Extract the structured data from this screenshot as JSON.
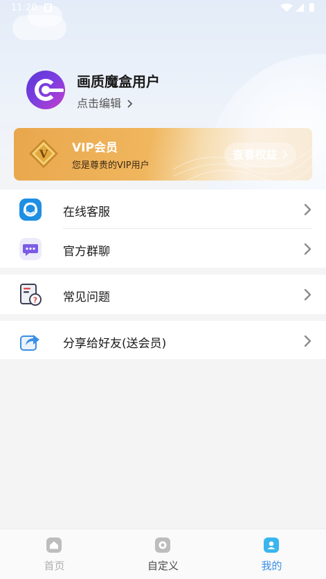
{
  "status_bar": {
    "time": "11:20"
  },
  "profile": {
    "name": "画质魔盒用户",
    "edit_label": "点击编辑"
  },
  "vip": {
    "title": "VIP会员",
    "subtitle": "您是尊贵的VIP用户",
    "button_label": "查看权益",
    "badge_letter": "V"
  },
  "menu": {
    "group1": [
      {
        "label": "在线客服",
        "icon": "customer-service-icon"
      },
      {
        "label": "官方群聊",
        "icon": "group-chat-icon"
      }
    ],
    "group2": [
      {
        "label": "常见问题",
        "icon": "faq-icon"
      }
    ],
    "group3": [
      {
        "label": "分享给好友(送会员)",
        "icon": "share-icon"
      }
    ]
  },
  "tabs": [
    {
      "label": "首页",
      "icon": "home-icon",
      "active": false
    },
    {
      "label": "自定义",
      "icon": "custom-icon",
      "active": false
    },
    {
      "label": "我的",
      "icon": "profile-icon",
      "active": true
    }
  ],
  "colors": {
    "accent": "#3aa0e8",
    "vip_gold": "#e9a74c",
    "background": "#f4f4f5"
  }
}
